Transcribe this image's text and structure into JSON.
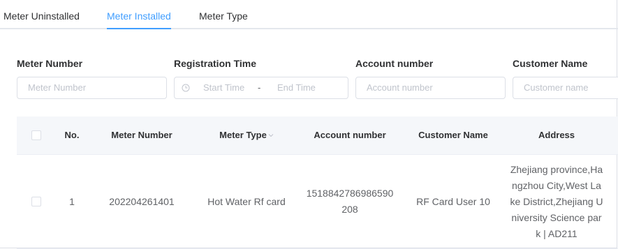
{
  "tabs": [
    {
      "label": "Meter Uninstalled",
      "active": false
    },
    {
      "label": "Meter Installed",
      "active": true
    },
    {
      "label": "Meter Type",
      "active": false
    }
  ],
  "colors": {
    "accent": "#409eff",
    "header_bg": "#f5f7fa",
    "border": "#dcdfe6"
  },
  "filters": {
    "meter_number": {
      "label": "Meter Number",
      "placeholder": "Meter Number"
    },
    "registration_time": {
      "label": "Registration Time",
      "start_placeholder": "Start Time",
      "separator": "-",
      "end_placeholder": "End Time",
      "icon": "clock-icon"
    },
    "account_number": {
      "label": "Account number",
      "placeholder": "Account number"
    },
    "customer_name": {
      "label": "Customer Name",
      "placeholder": "Customer name"
    }
  },
  "table": {
    "columns": [
      "No.",
      "Meter Number",
      "Meter Type",
      "Account number",
      "Customer Name",
      "Address"
    ],
    "sortable_column": "Meter Type",
    "rows": [
      {
        "no": "1",
        "meter_number": "202204261401",
        "meter_type": "Hot Water Rf card",
        "account_number": "1518842786986590208",
        "customer_name": "RF Card User 10",
        "address": "Zhejiang province,Hangzhou City,West Lake District,Zhejiang University Science park | AD211"
      }
    ]
  }
}
